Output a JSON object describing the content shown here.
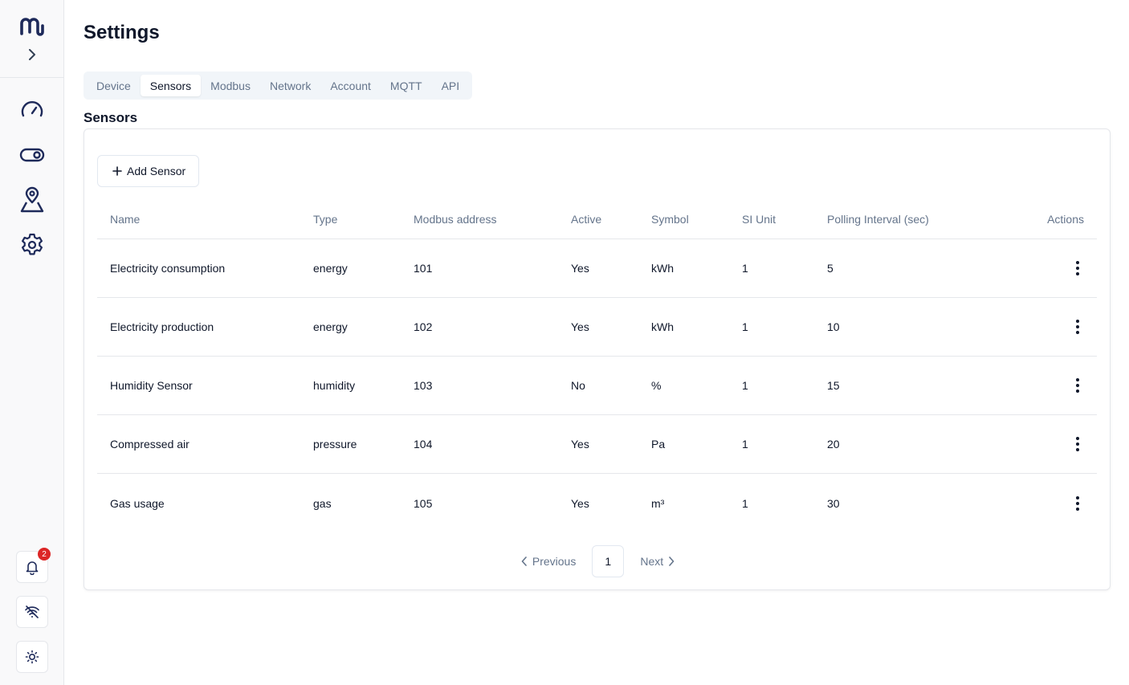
{
  "sidebar": {
    "logo": "m-logo",
    "expand_icon": "chevron-right-icon",
    "nav": [
      {
        "icon": "gauge-icon",
        "name": "dashboard"
      },
      {
        "icon": "toggle-icon",
        "name": "controls"
      },
      {
        "icon": "map-pin-icon",
        "name": "location"
      },
      {
        "icon": "gear-icon",
        "name": "settings"
      }
    ],
    "notifications_count": "2",
    "bottom": [
      {
        "icon": "bell-icon",
        "name": "notifications"
      },
      {
        "icon": "wifi-off-icon",
        "name": "connection"
      },
      {
        "icon": "sun-icon",
        "name": "theme"
      }
    ]
  },
  "page": {
    "title": "Settings",
    "section_title": "Sensors"
  },
  "tabs": [
    "Device",
    "Sensors",
    "Modbus",
    "Network",
    "Account",
    "MQTT",
    "API"
  ],
  "active_tab": "Sensors",
  "add_button": "Add Sensor",
  "table": {
    "columns": [
      "Name",
      "Type",
      "Modbus address",
      "Active",
      "Symbol",
      "SI Unit",
      "Polling Interval (sec)",
      "Actions"
    ],
    "rows": [
      [
        "Electricity consumption",
        "energy",
        "101",
        "Yes",
        "kWh",
        "1",
        "5"
      ],
      [
        "Electricity production",
        "energy",
        "102",
        "Yes",
        "kWh",
        "1",
        "10"
      ],
      [
        "Humidity Sensor",
        "humidity",
        "103",
        "No",
        "%",
        "1",
        "15"
      ],
      [
        "Compressed air",
        "pressure",
        "104",
        "Yes",
        "Pa",
        "1",
        "20"
      ],
      [
        "Gas usage",
        "gas",
        "105",
        "Yes",
        "m³",
        "1",
        "30"
      ]
    ]
  },
  "pagination": {
    "previous": "Previous",
    "current": "1",
    "next": "Next"
  },
  "colors": {
    "accent": "#1e2a5a",
    "badge": "#dc2626",
    "muted": "#64748b"
  }
}
